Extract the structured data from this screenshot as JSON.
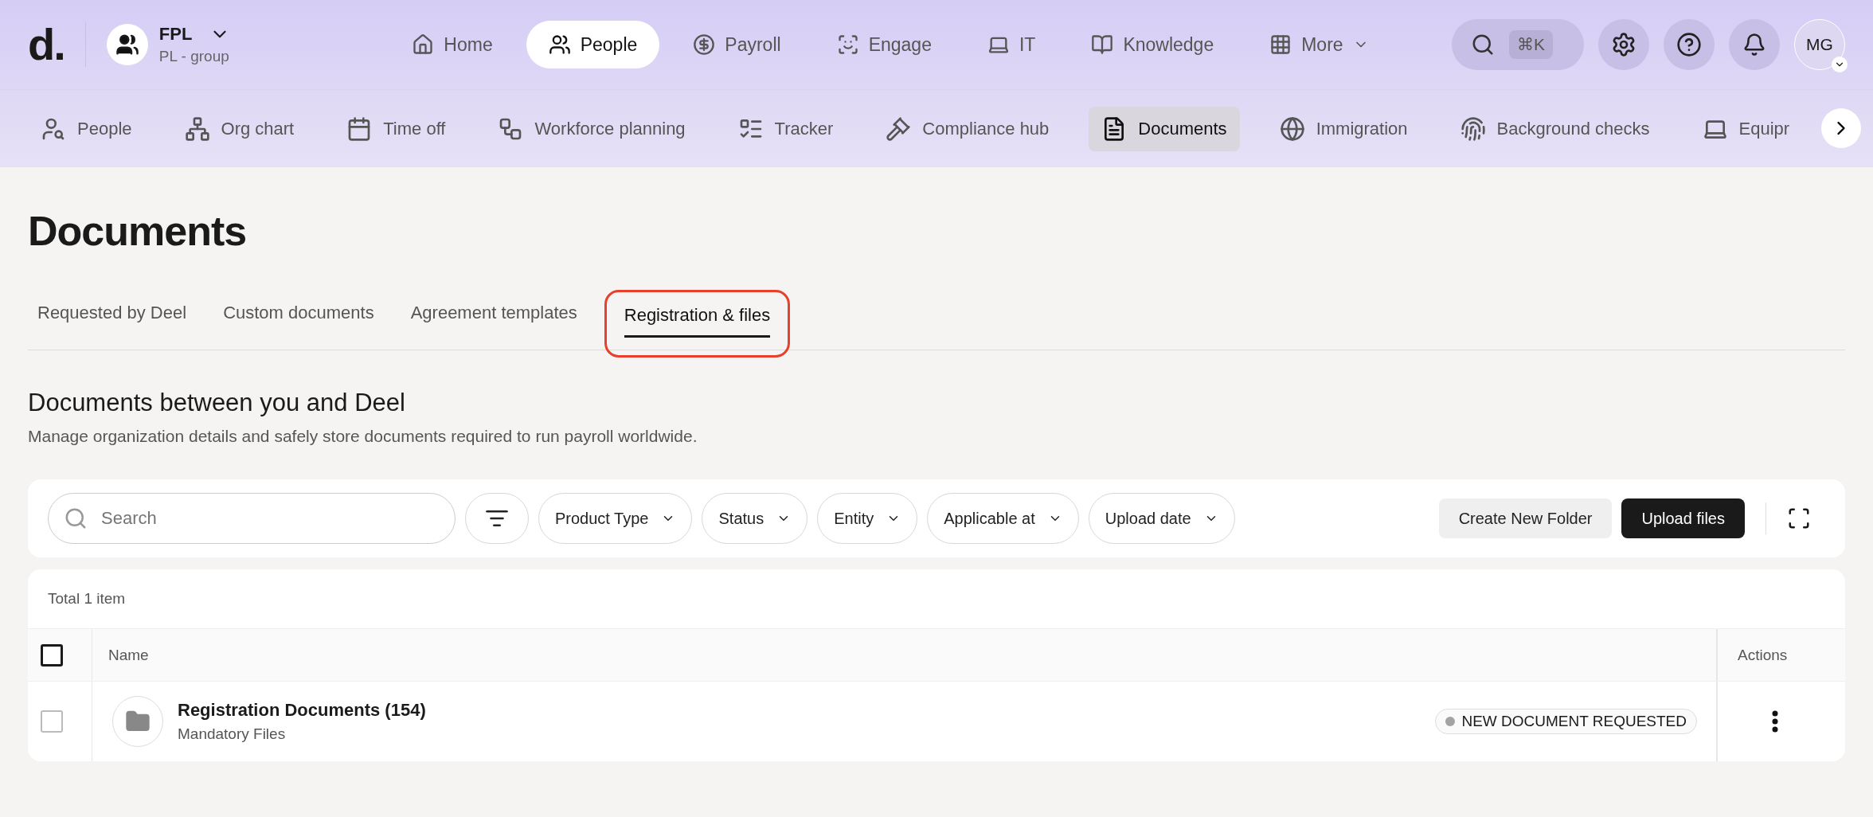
{
  "brand": {
    "logo": "d.",
    "org_name": "FPL",
    "org_sub": "PL - group"
  },
  "main_nav": [
    {
      "label": "Home",
      "selected": false
    },
    {
      "label": "People",
      "selected": true
    },
    {
      "label": "Payroll",
      "selected": false
    },
    {
      "label": "Engage",
      "selected": false
    },
    {
      "label": "IT",
      "selected": false
    },
    {
      "label": "Knowledge",
      "selected": false
    },
    {
      "label": "More",
      "selected": false
    }
  ],
  "search_shortcut": "⌘K",
  "avatar": "MG",
  "sub_nav": [
    {
      "label": "People",
      "selected": false
    },
    {
      "label": "Org chart",
      "selected": false
    },
    {
      "label": "Time off",
      "selected": false
    },
    {
      "label": "Workforce planning",
      "selected": false
    },
    {
      "label": "Tracker",
      "selected": false
    },
    {
      "label": "Compliance hub",
      "selected": false
    },
    {
      "label": "Documents",
      "selected": true
    },
    {
      "label": "Immigration",
      "selected": false
    },
    {
      "label": "Background checks",
      "selected": false
    },
    {
      "label": "Equipr",
      "selected": false
    }
  ],
  "page_title": "Documents",
  "tabs": [
    {
      "label": "Requested by Deel",
      "selected": false,
      "highlighted": false
    },
    {
      "label": "Custom documents",
      "selected": false,
      "highlighted": false
    },
    {
      "label": "Agreement templates",
      "selected": false,
      "highlighted": false
    },
    {
      "label": "Registration & files",
      "selected": true,
      "highlighted": true
    }
  ],
  "section": {
    "title": "Documents between you and Deel",
    "description": "Manage organization details and safely store documents required to run payroll worldwide."
  },
  "toolbar": {
    "search": {
      "placeholder": "Search"
    },
    "filters": [
      "Product Type",
      "Status",
      "Entity",
      "Applicable at",
      "Upload date"
    ],
    "buttons": [
      {
        "label": "Create New Folder",
        "kind": "secondary"
      },
      {
        "label": "Upload files",
        "kind": "primary"
      }
    ]
  },
  "table": {
    "total": "Total 1 item",
    "select_all_checked": false,
    "columns": [
      "Name",
      "Actions"
    ],
    "rows": [
      {
        "name": "Registration Documents (154)",
        "subtitle": "Mandatory Files",
        "status": "NEW DOCUMENT REQUESTED",
        "color": "#a3a3a3",
        "checked": false
      }
    ]
  }
}
